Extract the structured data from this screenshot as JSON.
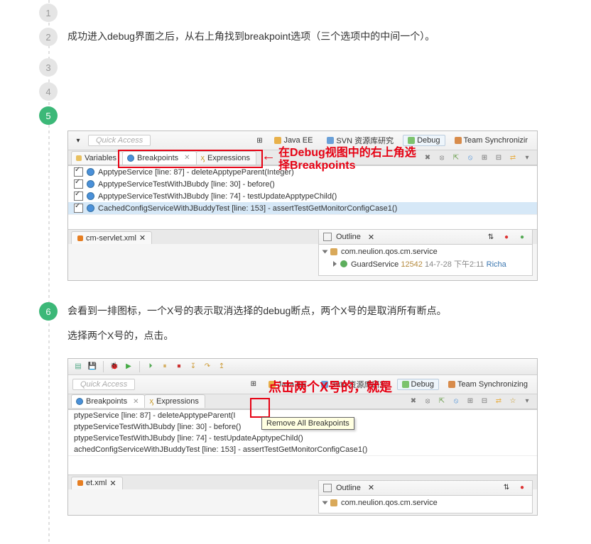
{
  "steps": {
    "nums": [
      "1",
      "2",
      "3",
      "4",
      "5",
      "6"
    ],
    "s2_text": "成功进入debug界面之后，从右上角找到breakpoint选项（三个选项中的中间一个）。",
    "s6_text_a": "会看到一排图标，一个X号的表示取消选择的debug断点，两个X号的是取消所有断点。",
    "s6_text_b": "选择两个X号的，点击。"
  },
  "shot1": {
    "quick_access": "Quick Access",
    "persp": {
      "javaee": "Java EE",
      "svn": "SVN 资源库研究",
      "debug": "Debug",
      "team": "Team Synchronizir"
    },
    "tabs": {
      "variables": "Variables",
      "breakpoints": "Breakpoints",
      "expressions": "Expressions"
    },
    "annot": {
      "l1": "在Debug视图中的右上角选",
      "l2": "择Breakpoints"
    },
    "bp": [
      "ApptypeService [line: 87] - deleteApptypeParent(Integer)",
      "ApptypeServiceTestWithJBubdy [line: 30] - before()",
      "ApptypeServiceTestWithJBubdy [line: 74] - testUpdateApptypeChild()",
      "CachedConfigServiceWithJBuddyTest [line: 153] - assertTestGetMonitorConfigCase1()"
    ],
    "bottom_tab": "cm-servlet.xml",
    "outline": {
      "label": "Outline",
      "pkg": "com.neulion.qos.cm.service",
      "cls": "GuardService",
      "rev": "12542",
      "date": "14-7-28 下午2:11",
      "auth": "Richa"
    }
  },
  "shot2": {
    "quick_access": "Quick Access",
    "persp": {
      "javaee": "Java EE",
      "svn": "SVN 资源库研究",
      "debug": "Debug",
      "team": "Team Synchronizing"
    },
    "tabs": {
      "breakpoints": "Breakpoints",
      "expressions": "Expressions"
    },
    "annot": "点击两个X号的，就是",
    "tooltip": "Remove All Breakpoints",
    "bp": [
      "ptypeService [line: 87] - deleteApptypeParent(I",
      "ptypeServiceTestWithJBubdy [line: 30] - before()",
      "ptypeServiceTestWithJBubdy [line: 74] - testUpdateApptypeChild()",
      "achedConfigServiceWithJBuddyTest [line: 153] - assertTestGetMonitorConfigCase1()"
    ],
    "bottom_tab": "et.xml",
    "outline": {
      "label": "Outline",
      "pkg": "com.neulion.qos.cm.service"
    }
  }
}
